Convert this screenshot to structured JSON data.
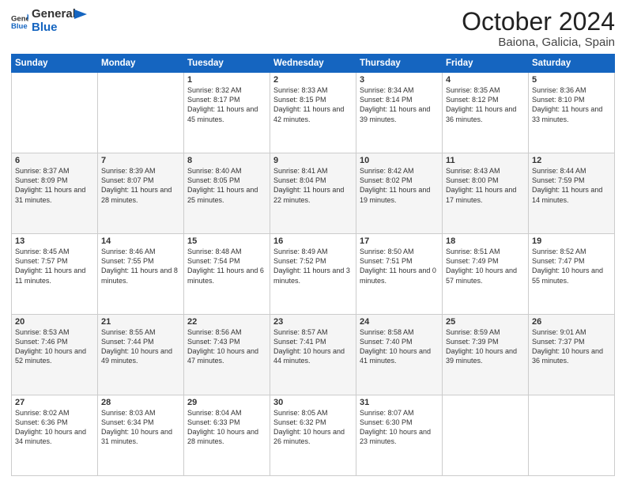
{
  "header": {
    "logo_general": "General",
    "logo_blue": "Blue",
    "title": "October 2024",
    "location": "Baiona, Galicia, Spain"
  },
  "weekdays": [
    "Sunday",
    "Monday",
    "Tuesday",
    "Wednesday",
    "Thursday",
    "Friday",
    "Saturday"
  ],
  "weeks": [
    [
      {
        "day": "",
        "info": ""
      },
      {
        "day": "",
        "info": ""
      },
      {
        "day": "1",
        "info": "Sunrise: 8:32 AM\nSunset: 8:17 PM\nDaylight: 11 hours and 45 minutes."
      },
      {
        "day": "2",
        "info": "Sunrise: 8:33 AM\nSunset: 8:15 PM\nDaylight: 11 hours and 42 minutes."
      },
      {
        "day": "3",
        "info": "Sunrise: 8:34 AM\nSunset: 8:14 PM\nDaylight: 11 hours and 39 minutes."
      },
      {
        "day": "4",
        "info": "Sunrise: 8:35 AM\nSunset: 8:12 PM\nDaylight: 11 hours and 36 minutes."
      },
      {
        "day": "5",
        "info": "Sunrise: 8:36 AM\nSunset: 8:10 PM\nDaylight: 11 hours and 33 minutes."
      }
    ],
    [
      {
        "day": "6",
        "info": "Sunrise: 8:37 AM\nSunset: 8:09 PM\nDaylight: 11 hours and 31 minutes."
      },
      {
        "day": "7",
        "info": "Sunrise: 8:39 AM\nSunset: 8:07 PM\nDaylight: 11 hours and 28 minutes."
      },
      {
        "day": "8",
        "info": "Sunrise: 8:40 AM\nSunset: 8:05 PM\nDaylight: 11 hours and 25 minutes."
      },
      {
        "day": "9",
        "info": "Sunrise: 8:41 AM\nSunset: 8:04 PM\nDaylight: 11 hours and 22 minutes."
      },
      {
        "day": "10",
        "info": "Sunrise: 8:42 AM\nSunset: 8:02 PM\nDaylight: 11 hours and 19 minutes."
      },
      {
        "day": "11",
        "info": "Sunrise: 8:43 AM\nSunset: 8:00 PM\nDaylight: 11 hours and 17 minutes."
      },
      {
        "day": "12",
        "info": "Sunrise: 8:44 AM\nSunset: 7:59 PM\nDaylight: 11 hours and 14 minutes."
      }
    ],
    [
      {
        "day": "13",
        "info": "Sunrise: 8:45 AM\nSunset: 7:57 PM\nDaylight: 11 hours and 11 minutes."
      },
      {
        "day": "14",
        "info": "Sunrise: 8:46 AM\nSunset: 7:55 PM\nDaylight: 11 hours and 8 minutes."
      },
      {
        "day": "15",
        "info": "Sunrise: 8:48 AM\nSunset: 7:54 PM\nDaylight: 11 hours and 6 minutes."
      },
      {
        "day": "16",
        "info": "Sunrise: 8:49 AM\nSunset: 7:52 PM\nDaylight: 11 hours and 3 minutes."
      },
      {
        "day": "17",
        "info": "Sunrise: 8:50 AM\nSunset: 7:51 PM\nDaylight: 11 hours and 0 minutes."
      },
      {
        "day": "18",
        "info": "Sunrise: 8:51 AM\nSunset: 7:49 PM\nDaylight: 10 hours and 57 minutes."
      },
      {
        "day": "19",
        "info": "Sunrise: 8:52 AM\nSunset: 7:47 PM\nDaylight: 10 hours and 55 minutes."
      }
    ],
    [
      {
        "day": "20",
        "info": "Sunrise: 8:53 AM\nSunset: 7:46 PM\nDaylight: 10 hours and 52 minutes."
      },
      {
        "day": "21",
        "info": "Sunrise: 8:55 AM\nSunset: 7:44 PM\nDaylight: 10 hours and 49 minutes."
      },
      {
        "day": "22",
        "info": "Sunrise: 8:56 AM\nSunset: 7:43 PM\nDaylight: 10 hours and 47 minutes."
      },
      {
        "day": "23",
        "info": "Sunrise: 8:57 AM\nSunset: 7:41 PM\nDaylight: 10 hours and 44 minutes."
      },
      {
        "day": "24",
        "info": "Sunrise: 8:58 AM\nSunset: 7:40 PM\nDaylight: 10 hours and 41 minutes."
      },
      {
        "day": "25",
        "info": "Sunrise: 8:59 AM\nSunset: 7:39 PM\nDaylight: 10 hours and 39 minutes."
      },
      {
        "day": "26",
        "info": "Sunrise: 9:01 AM\nSunset: 7:37 PM\nDaylight: 10 hours and 36 minutes."
      }
    ],
    [
      {
        "day": "27",
        "info": "Sunrise: 8:02 AM\nSunset: 6:36 PM\nDaylight: 10 hours and 34 minutes."
      },
      {
        "day": "28",
        "info": "Sunrise: 8:03 AM\nSunset: 6:34 PM\nDaylight: 10 hours and 31 minutes."
      },
      {
        "day": "29",
        "info": "Sunrise: 8:04 AM\nSunset: 6:33 PM\nDaylight: 10 hours and 28 minutes."
      },
      {
        "day": "30",
        "info": "Sunrise: 8:05 AM\nSunset: 6:32 PM\nDaylight: 10 hours and 26 minutes."
      },
      {
        "day": "31",
        "info": "Sunrise: 8:07 AM\nSunset: 6:30 PM\nDaylight: 10 hours and 23 minutes."
      },
      {
        "day": "",
        "info": ""
      },
      {
        "day": "",
        "info": ""
      }
    ]
  ]
}
